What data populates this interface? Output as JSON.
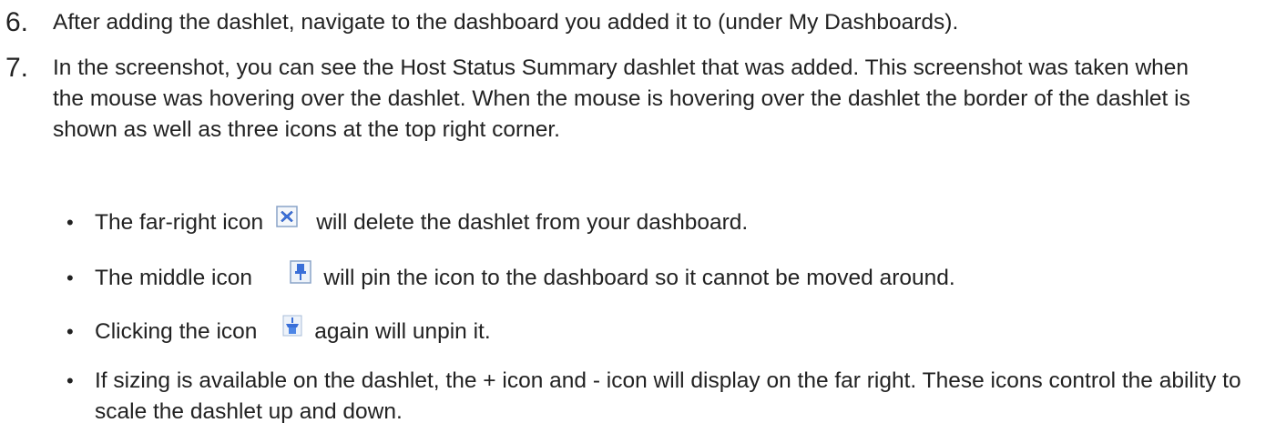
{
  "steps": [
    {
      "number": "6.",
      "text": "After adding the dashlet, navigate to the dashboard you added it to (under My Dashboards)."
    },
    {
      "number": "7.",
      "text": "In the screenshot, you can see the Host Status Summary dashlet that was added.  This screenshot was taken when the mouse was hovering over the dashlet.  When the mouse is hovering over the dashlet the border of the dashlet is shown as well as three icons at the top right corner."
    }
  ],
  "bullets": [
    {
      "before": "The far-right icon",
      "icon": "delete-x-icon",
      "after": "will delete the dashlet from your dashboard."
    },
    {
      "before": "The middle icon",
      "icon": "pin-icon",
      "after": "will pin the icon to the dashboard so it cannot be moved around."
    },
    {
      "before": "Clicking the icon",
      "icon": "unpin-icon",
      "after": "again will unpin it."
    },
    {
      "text": "If sizing is available on the dashlet, the + icon and - icon will display on the far right.  These icons control the ability to scale the dashlet up and down."
    }
  ],
  "bullet_symbol": "•",
  "colors": {
    "text": "#222222",
    "icon_blue": "#3a6fd8",
    "icon_border": "#8aa4c8"
  }
}
